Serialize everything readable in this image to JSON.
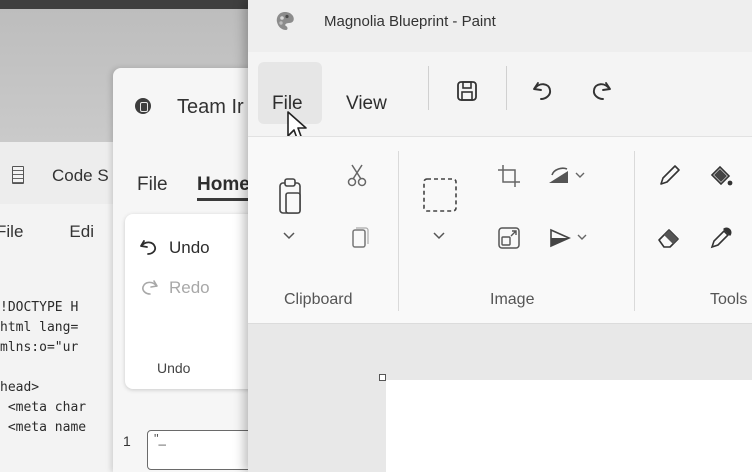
{
  "code_window": {
    "title": "Code S",
    "menu": [
      "File",
      "Edi"
    ],
    "lines": [
      "!DOCTYPE H",
      "html lang=",
      "mlns:o=\"ur",
      "",
      "head>",
      " <meta char",
      " <meta name"
    ]
  },
  "team_window": {
    "title": "Team Ir",
    "tabs": {
      "file": "File",
      "home": "Home"
    },
    "undo_label": "Undo",
    "redo_label": "Redo",
    "group_label": "Undo",
    "bottom_number": "1",
    "bottom_field_text": "\"_"
  },
  "paint_window": {
    "title": "Magnolia Blueprint - Paint",
    "menu": {
      "file": "File",
      "view": "View"
    },
    "groups": {
      "clipboard": "Clipboard",
      "image": "Image",
      "tools": "Tools"
    }
  },
  "icons": {
    "save": "save-icon",
    "undo": "undo-icon",
    "redo": "redo-icon",
    "paste": "paste-icon",
    "cut": "cut-icon",
    "copy": "copy-icon",
    "select": "select-icon",
    "crop": "crop-icon",
    "resize": "resize-icon",
    "rotate": "rotate-icon",
    "flip": "flip-icon",
    "pencil": "pencil-icon",
    "fill": "fill-icon",
    "eraser": "eraser-icon",
    "picker": "color-picker-icon"
  },
  "colors": {
    "paint_bg": "#f3f3f3",
    "ribbon_bg": "#f9f9f9",
    "canvas_bg": "#e8e8e8"
  }
}
